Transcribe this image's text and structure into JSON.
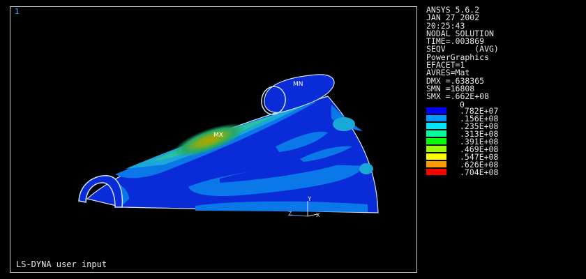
{
  "viewport": {
    "window_number": "1",
    "bottom_title": "LS-DYNA user input",
    "labels": {
      "max": "MX",
      "min": "MN",
      "axis_y": "Y",
      "axis_x": "X",
      "axis_z": "Z"
    }
  },
  "info": {
    "lines": [
      "ANSYS 5.6.2",
      "JAN 27 2002",
      "20:25:43",
      "NODAL SOLUTION",
      "TIME=.003869",
      "SEQV      (AVG)",
      "PowerGraphics",
      "EFACET=1",
      "AVRES=Mat",
      "DMX =.638365",
      "SMN =16808",
      "SMX =.662E+08"
    ]
  },
  "legend": {
    "zero_label": "0",
    "entries": [
      {
        "label": ".782E+07",
        "color": "#0000ff"
      },
      {
        "label": ".156E+08",
        "color": "#0099ff"
      },
      {
        "label": ".235E+08",
        "color": "#00e5ff"
      },
      {
        "label": ".313E+08",
        "color": "#00ff99"
      },
      {
        "label": ".391E+08",
        "color": "#00ff00"
      },
      {
        "label": ".469E+08",
        "color": "#99ff00"
      },
      {
        "label": ".547E+08",
        "color": "#ffff00"
      },
      {
        "label": ".626E+08",
        "color": "#ff9900"
      },
      {
        "label": ".704E+08",
        "color": "#ff0000"
      }
    ]
  }
}
